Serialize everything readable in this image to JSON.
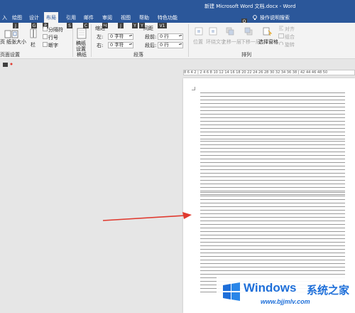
{
  "window": {
    "title": "新建 Microsoft Word 文档.docx  -  Word",
    "brand": "Word"
  },
  "tabs": [
    {
      "label": "入",
      "key": ""
    },
    {
      "label": "绘图",
      "key": ""
    },
    {
      "label": "设计",
      "key": ""
    },
    {
      "label": "布局",
      "key": "",
      "active": true
    },
    {
      "label": "引用",
      "key": ""
    },
    {
      "label": "邮件",
      "key": ""
    },
    {
      "label": "审阅",
      "key": ""
    },
    {
      "label": "视图",
      "key": ""
    },
    {
      "label": "帮助",
      "key": ""
    },
    {
      "label": "特色功能",
      "key": ""
    }
  ],
  "tell_me": {
    "label": "操作说明搜索",
    "key": "Q"
  },
  "keytips": [
    "J",
    "G",
    "P",
    "S",
    "C",
    "H",
    "J",
    "Y",
    "Y",
    "V",
    "V1"
  ],
  "page_setup": {
    "items": [
      "页",
      "纸张大小",
      "栏"
    ],
    "small_items": [
      "分隔符",
      "行号",
      "断字"
    ],
    "group_label": "页面设置"
  },
  "manuscript": {
    "label": "稿纸设置",
    "group_label": "稿纸"
  },
  "paragraph": {
    "indent_label": "缩进",
    "spacing_label": "间距",
    "left_label": "左:",
    "left_value": "0 字符",
    "right_label": "右:",
    "right_value": "0 字符",
    "before_label": "段前:",
    "before_value": "0 行",
    "after_label": "段后:",
    "after_value": "0 行",
    "group_label": "段落"
  },
  "arrange": {
    "items": [
      "位置",
      "环绕文字",
      "上移一层",
      "下移一层",
      "选择窗格"
    ],
    "small_items": [
      "对齐",
      "组合",
      "旋转"
    ],
    "group_label": "排列"
  },
  "ruler": {
    "text": "8 6 4 2 | 2  4  6  8 10 12 14 16 18 20 22 24 26 28 30 32 34 36 38 |  42 44 46 48 50"
  },
  "watermark": {
    "title": "Windows",
    "subtitle": "系统之家",
    "url": "www.bjjmlv.com"
  },
  "colors": {
    "ribbon_blue": "#2b579a",
    "arrow_red": "#e03a2f",
    "watermark_blue": "#1e6fd9"
  }
}
